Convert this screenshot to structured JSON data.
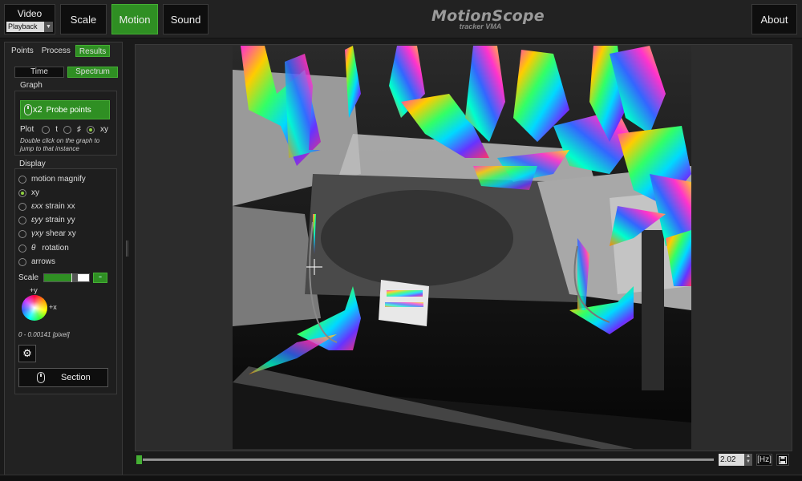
{
  "topbar": {
    "video_label": "Video",
    "video_mode": "Playback",
    "scale_label": "Scale",
    "motion_label": "Motion",
    "sound_label": "Sound",
    "about_label": "About",
    "brand_name": "MotionScope",
    "brand_sub": "tracker VMA"
  },
  "left_tabs": [
    "Points",
    "Process",
    "Results"
  ],
  "graph": {
    "time_label": "Time",
    "spectrum_label": "Spectrum",
    "title": "Graph",
    "probe_multiplier": "x2",
    "probe_label": "Probe points",
    "plot_label": "Plot",
    "plot_options": [
      "t",
      "♯",
      "xy"
    ],
    "hint": "Double click on the graph to jump to that instance"
  },
  "display": {
    "title": "Display",
    "items": [
      {
        "symbol": "",
        "label": "motion magnify"
      },
      {
        "symbol": "",
        "label": "xy"
      },
      {
        "symbol": "εxx",
        "label": "strain xx"
      },
      {
        "symbol": "εyy",
        "label": "strain yy"
      },
      {
        "symbol": "γxy",
        "label": "shear xy"
      },
      {
        "symbol": "θ",
        "label": "rotation"
      },
      {
        "symbol": "",
        "label": "arrows"
      }
    ],
    "scale_label": "Scale",
    "plus_y": "+y",
    "plus_x": "+x",
    "range_text": "0 - 0.00141 [pixel]",
    "section_label": "Section"
  },
  "timeline": {
    "frequency": "2.02",
    "unit": "[Hz]"
  },
  "colors": {
    "accent": "#2f8f23",
    "accent_border": "#45b034",
    "panel": "#222222"
  }
}
